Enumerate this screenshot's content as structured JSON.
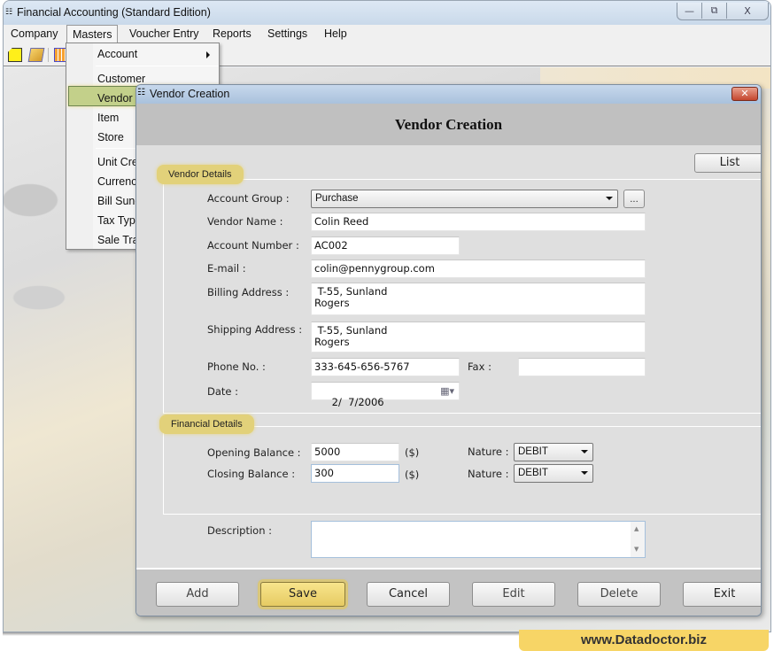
{
  "app": {
    "title": "Financial Accounting (Standard Edition)",
    "window_controls": {
      "minimize": "—",
      "restore": "⧉",
      "close": "X"
    }
  },
  "menu_bar": {
    "items": [
      "Company",
      "Masters",
      "Voucher Entry",
      "Reports",
      "Settings",
      "Help"
    ]
  },
  "toolbar": {
    "icons": [
      "new-document-icon",
      "open-folder-icon",
      "calculator-icon"
    ]
  },
  "masters_menu": {
    "items": [
      {
        "label": "Account",
        "has_submenu": true
      },
      {
        "label": "Customer"
      },
      {
        "label": "Vendor",
        "highlighted": true
      },
      {
        "label": "Item"
      },
      {
        "label": "Store"
      },
      {
        "label": "Unit Cre"
      },
      {
        "label": "Currency"
      },
      {
        "label": "Bill Sunc"
      },
      {
        "label": "Tax Type"
      },
      {
        "label": "Sale Tra"
      }
    ]
  },
  "dialog": {
    "window_title": "Vendor Creation",
    "heading": "Vendor Creation",
    "list_button": "List",
    "vendor_details": {
      "group_label": "Vendor Details",
      "account_group": {
        "label": "Account Group :",
        "value": "Purchase",
        "browse_button": "..."
      },
      "vendor_name": {
        "label": "Vendor Name :",
        "value": "Colin Reed"
      },
      "account_number": {
        "label": "Account Number :",
        "value": "AC002"
      },
      "email": {
        "label": "E-mail :",
        "value": "colin@pennygroup.com"
      },
      "billing_address": {
        "label": "Billing Address :",
        "value": " T-55, Sunland\nRogers"
      },
      "shipping_address": {
        "label": "Shipping Address :",
        "value": " T-55, Sunland\nRogers"
      },
      "phone": {
        "label": "Phone No. :",
        "value": "333-645-656-5767"
      },
      "fax": {
        "label": "Fax :",
        "value": ""
      },
      "date": {
        "label": "Date :",
        "value": "2/  7/2006"
      }
    },
    "financial_details": {
      "group_label": "Financial Details",
      "opening_balance": {
        "label": "Opening Balance :",
        "value": "5000",
        "unit": "($)",
        "nature_label": "Nature :",
        "nature": "DEBIT"
      },
      "closing_balance": {
        "label": "Closing Balance :",
        "value": "300",
        "unit": "($)",
        "nature_label": "Nature :",
        "nature": "DEBIT"
      }
    },
    "description": {
      "label": "Description :",
      "value": ""
    },
    "buttons": {
      "add": "Add",
      "save": "Save",
      "cancel": "Cancel",
      "edit": "Edit",
      "delete": "Delete",
      "exit": "Exit"
    }
  },
  "watermark": "www.Datadoctor.biz"
}
